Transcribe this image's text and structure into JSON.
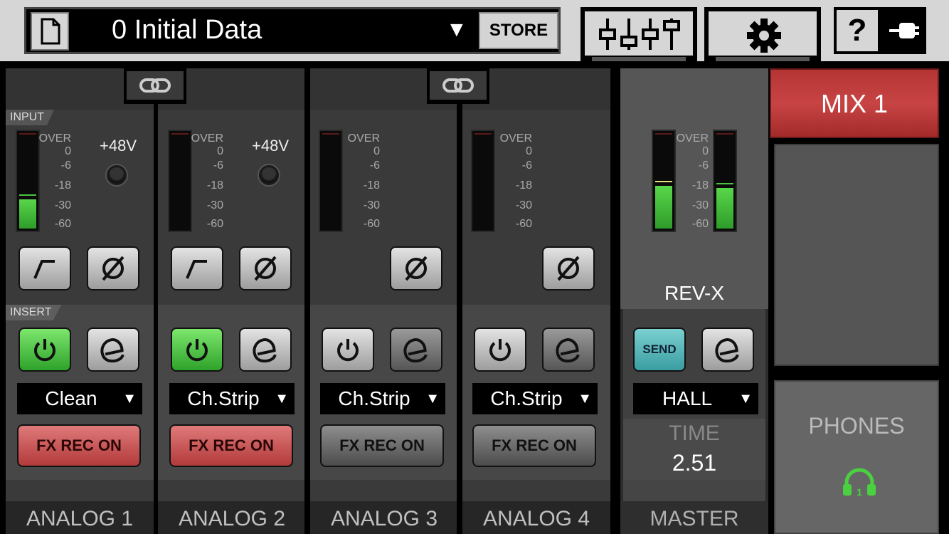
{
  "topbar": {
    "scene_name": "0  Initial Data",
    "scene_arrow": "▼",
    "store_label": "STORE",
    "help_label": "?"
  },
  "channels": [
    {
      "name": "ANALOG 1",
      "section_input": "INPUT",
      "section_insert": "INSERT",
      "phantom": "+48V",
      "effect": "Clean",
      "fx_rec": "FX REC ON",
      "meter_level": 0.3,
      "insert_on": true,
      "fx_rec_on": true
    },
    {
      "name": "ANALOG 2",
      "phantom": "+48V",
      "effect": "Ch.Strip",
      "fx_rec": "FX REC ON",
      "meter_level": 0,
      "insert_on": true,
      "fx_rec_on": true
    },
    {
      "name": "ANALOG 3",
      "effect": "Ch.Strip",
      "fx_rec": "FX REC ON",
      "meter_level": 0,
      "insert_on": false,
      "fx_rec_on": false
    },
    {
      "name": "ANALOG 4",
      "effect": "Ch.Strip",
      "fx_rec": "FX REC ON",
      "meter_level": 0,
      "insert_on": false,
      "fx_rec_on": false
    }
  ],
  "meter_scale": [
    "OVER",
    "0",
    "-6",
    "-18",
    "-30",
    "-60"
  ],
  "master": {
    "name": "MASTER",
    "reverb_name": "REV-X",
    "send_label": "SEND",
    "reverb_type": "HALL",
    "time_label": "TIME",
    "time_value": "2.51",
    "meter_left": 0.44,
    "meter_right": 0.42
  },
  "mix": {
    "label": "MIX 1"
  },
  "phones": {
    "label": "PHONES",
    "badge": "1"
  },
  "colors": {
    "green": "#4ad13f",
    "red_active": "#b33434",
    "teal": "#5bbac0"
  },
  "icons": [
    "document-icon",
    "mixer-icon",
    "gear-icon",
    "connection-icon",
    "link-icon",
    "hpf-icon",
    "phase-icon",
    "power-icon",
    "edit-icon",
    "headphones-icon"
  ]
}
